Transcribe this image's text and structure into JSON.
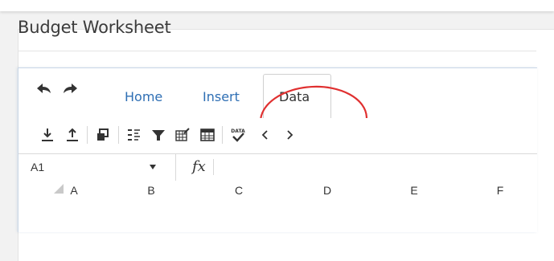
{
  "page": {
    "title": "Budget Worksheet"
  },
  "ribbon": {
    "tabs": [
      {
        "label": "Home"
      },
      {
        "label": "Insert"
      },
      {
        "label": "Data",
        "active": true
      }
    ]
  },
  "toolbar": {
    "icons": [
      "download-icon",
      "upload-icon",
      "paste-special-icon",
      "sort-icon",
      "filter-icon",
      "data-validation-icon",
      "table-icon",
      "spellcheck-data-icon",
      "chevron-left-icon",
      "chevron-right-icon"
    ],
    "spellcheck_badge": "DATA"
  },
  "formula_bar": {
    "cell_ref": "A1",
    "fx_label": "fx",
    "formula": ""
  },
  "columns": [
    "A",
    "B",
    "C",
    "D",
    "E",
    "F"
  ],
  "colors": {
    "accent": "#2f6fb4",
    "annotation": "#e03030"
  }
}
